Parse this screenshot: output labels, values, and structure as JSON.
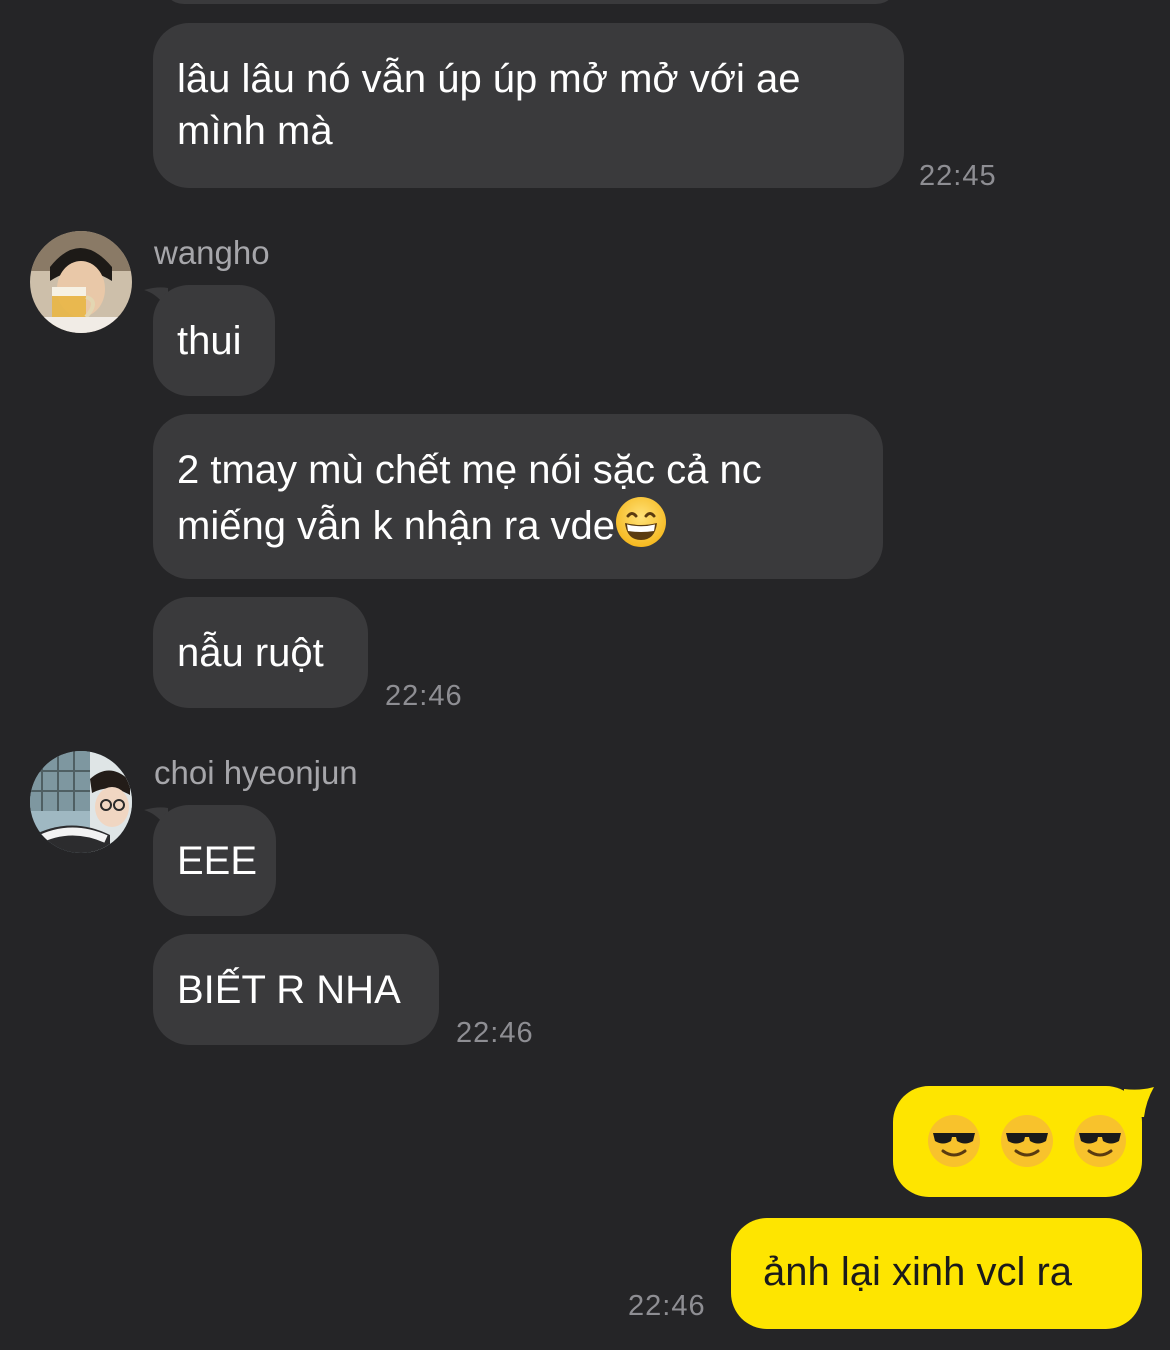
{
  "messages": {
    "m0": {
      "text_line1": "lâu lâu nó vẫn úp úp mở mở với ae",
      "text_line2": "mình mà",
      "time": "22:45"
    },
    "wangho": {
      "sender": "wangho",
      "m1": "thui",
      "m2_line1": "2 tmay mù chết mẹ nói sặc cả nc",
      "m2_line2": "miếng vẫn k nhận ra vde",
      "m2_emoji": "grinning-face",
      "m3": "nẫu ruột",
      "time": "22:46"
    },
    "choi": {
      "sender": "choi hyeonjun",
      "m1": "EEE",
      "m2": "BIẾT R NHA",
      "time": "22:46"
    },
    "me": {
      "m1_emojis": [
        "smiling-face-with-sunglasses",
        "smiling-face-with-sunglasses",
        "smiling-face-with-sunglasses"
      ],
      "m2": "ảnh lại xinh vcl ra",
      "time": "22:46"
    }
  },
  "colors": {
    "background": "#252527",
    "received_bubble": "#3a3a3c",
    "sent_bubble": "#fee500",
    "timestamp": "#8e8e93",
    "sender_name": "#a6a6aa"
  }
}
